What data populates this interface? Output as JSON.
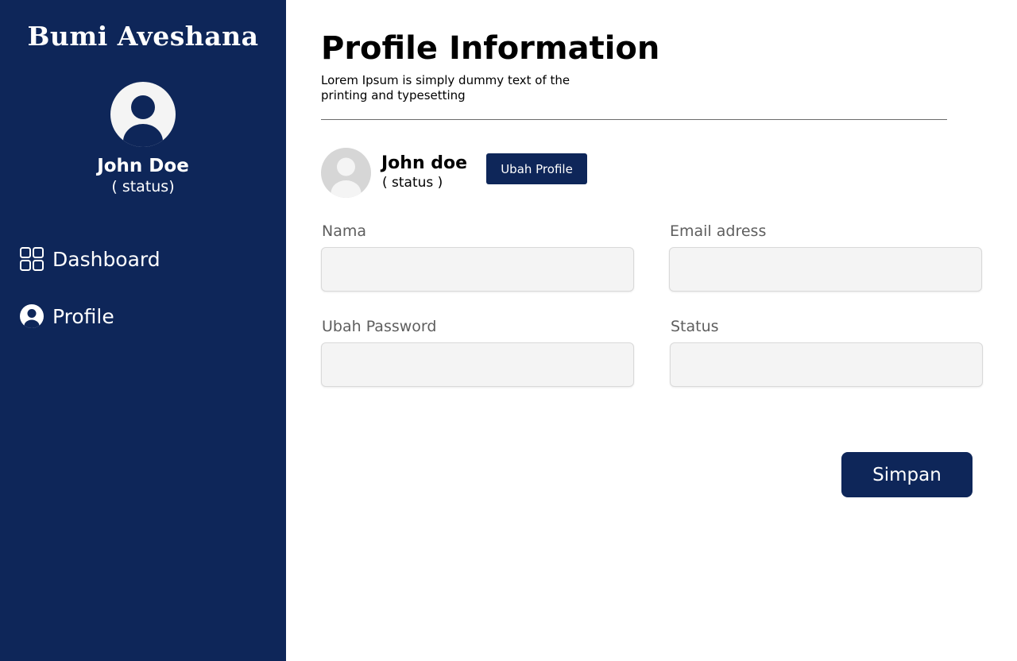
{
  "sidebar": {
    "brand": "Bumi Aveshana",
    "user": {
      "name": "John Doe",
      "status": "( status)",
      "avatar_icon": "user-avatar-icon"
    },
    "nav": [
      {
        "label": "Dashboard",
        "icon": "grid-icon"
      },
      {
        "label": "Profile",
        "icon": "user-circle-icon"
      }
    ]
  },
  "main": {
    "title": "Profile Information",
    "subtitle": "Lorem Ipsum is simply dummy text of the printing and typesetting",
    "profile": {
      "name": "John doe",
      "status": "( status )",
      "avatar_icon": "user-avatar-icon",
      "change_button": "Ubah Profile"
    },
    "form": {
      "fields": [
        {
          "label": "Nama",
          "value": ""
        },
        {
          "label": "Email adress",
          "value": ""
        },
        {
          "label": "Ubah Password",
          "value": ""
        },
        {
          "label": "Status",
          "value": ""
        }
      ],
      "submit_label": "Simpan"
    }
  },
  "colors": {
    "sidebar_bg": "#0e2659",
    "accent": "#0e2659",
    "input_bg": "#f4f4f4",
    "label_text": "#5e5e5e"
  }
}
